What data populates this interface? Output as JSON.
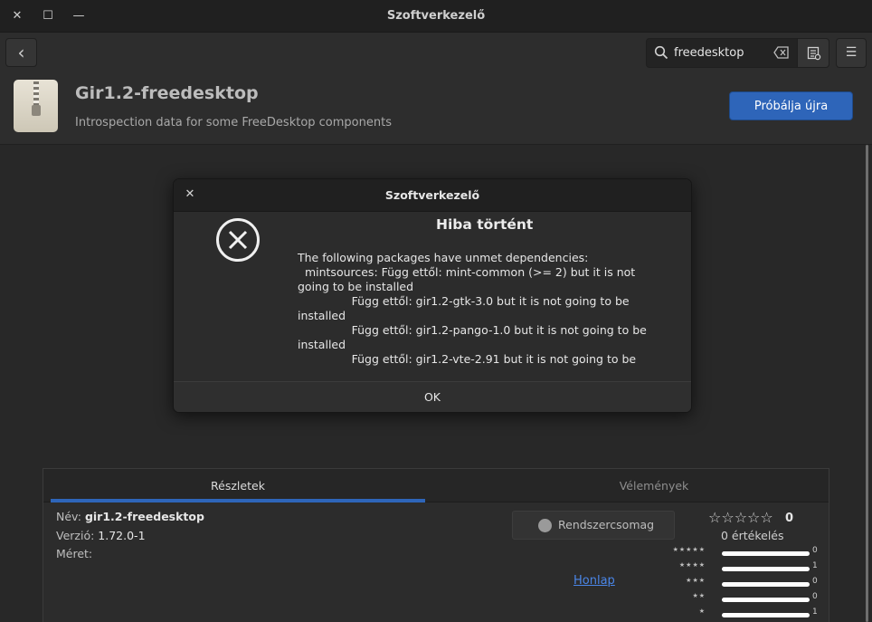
{
  "window": {
    "title": "Szoftverkezelő",
    "close_glyph": "✕",
    "maximize_glyph": "☐",
    "minimize_glyph": "—"
  },
  "toolbar": {
    "back_glyph": "‹",
    "search_value": "freedesktop",
    "menu_glyph": "☰"
  },
  "app": {
    "name": "Gir1.2-freedesktop",
    "description": "Introspection data for some FreeDesktop components",
    "retry_label": "Próbálja újra"
  },
  "tabs": {
    "details": "Részletek",
    "reviews": "Vélemények"
  },
  "details": {
    "name_label": "Név:",
    "name_value": "gir1.2-freedesktop",
    "version_label": "Verzió:",
    "version_value": "1.72.0-1",
    "size_label": "Méret:",
    "package_button": "Rendszercsomag",
    "homepage_link": "Honlap"
  },
  "rating": {
    "stars_glyph": "☆☆☆☆☆",
    "average": "0",
    "count_text": "0 értékelés",
    "rows": [
      {
        "stars": "★★★★★",
        "count": "0"
      },
      {
        "stars": "★★★★",
        "count": "1"
      },
      {
        "stars": "★★★",
        "count": "0"
      },
      {
        "stars": "★★",
        "count": "0"
      },
      {
        "stars": "★",
        "count": "1"
      }
    ]
  },
  "dialog": {
    "title": "Szoftverkezelő",
    "close_glyph": "✕",
    "heading": "Hiba történt",
    "message": "The following packages have unmet dependencies:\n  mintsources: Függ ettől: mint-common (>= 2) but it is not going to be installed\n               Függ ettől: gir1.2-gtk-3.0 but it is not going to be installed\n               Függ ettől: gir1.2-pango-1.0 but it is not going to be installed\n               Függ ettől: gir1.2-vte-2.91 but it is not going to be",
    "ok_label": "OK"
  }
}
